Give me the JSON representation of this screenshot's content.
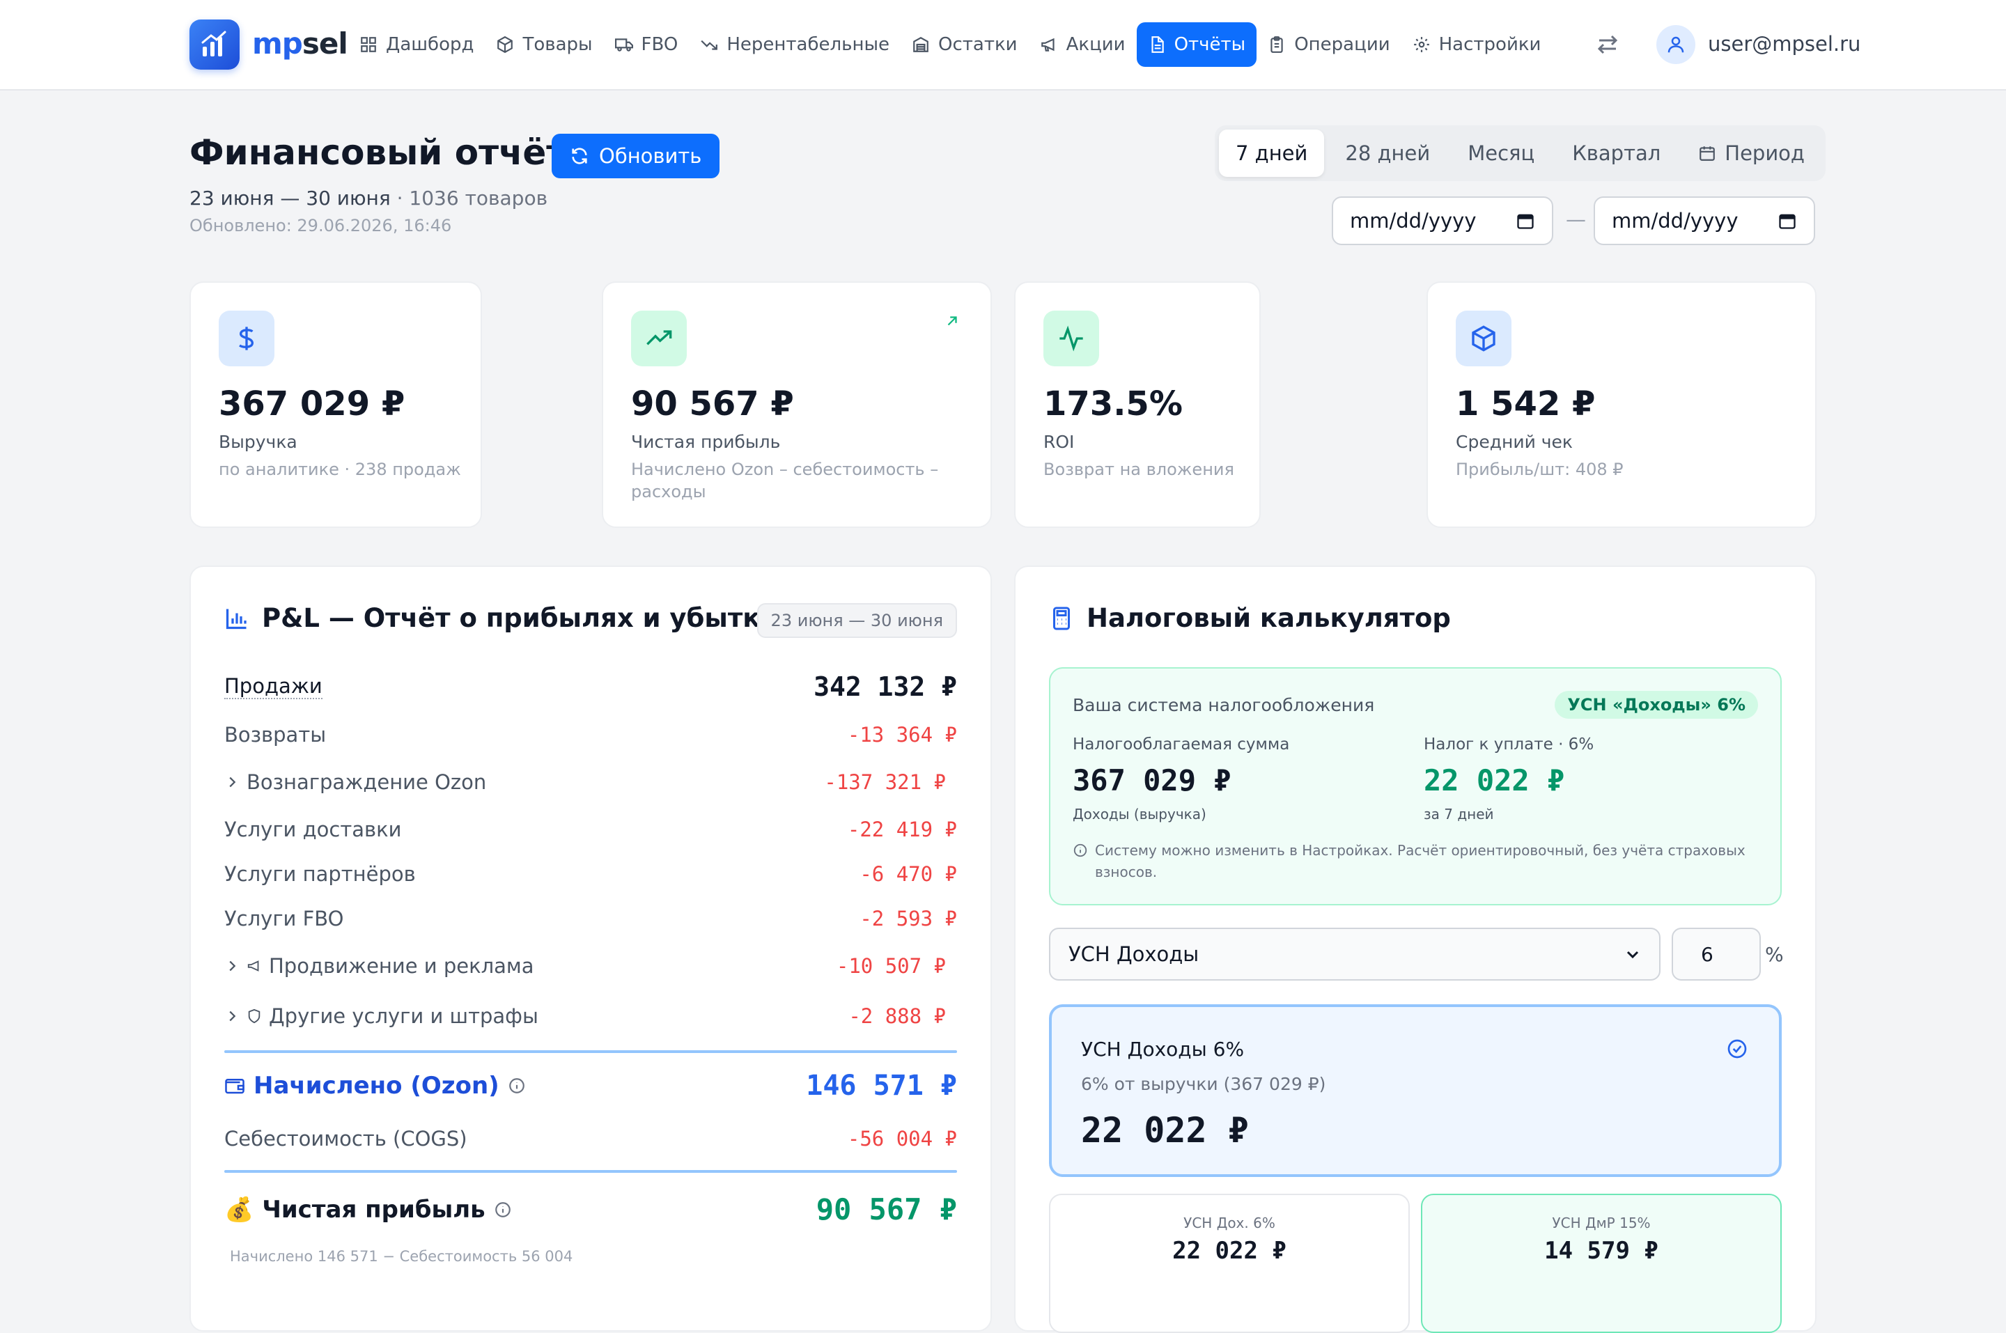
{
  "brand": {
    "part1": "mp",
    "part2": "sel"
  },
  "nav": [
    {
      "label": "Дашборд",
      "icon": "grid-icon",
      "active": false
    },
    {
      "label": "Товары",
      "icon": "box-icon",
      "active": false
    },
    {
      "label": "FBO",
      "icon": "truck-icon",
      "active": false
    },
    {
      "label": "Нерентабельные",
      "icon": "trending-down-icon",
      "active": false
    },
    {
      "label": "Остатки",
      "icon": "warehouse-icon",
      "active": false
    },
    {
      "label": "Акции",
      "icon": "megaphone-icon",
      "active": false
    },
    {
      "label": "Отчёты",
      "icon": "file-icon",
      "active": true
    },
    {
      "label": "Операции",
      "icon": "clipboard-icon",
      "active": false
    },
    {
      "label": "Настройки",
      "icon": "gear-icon",
      "active": false
    }
  ],
  "user": {
    "email": "user@mpsel.ru"
  },
  "page": {
    "title": "Финансовый отчёт",
    "refresh_label": "Обновить",
    "date_range": "23 июня — 30 июня",
    "products": "· 1036 товаров",
    "updated": "Обновлено: 29.06.2026, 16:46"
  },
  "periods": [
    "7 дней",
    "28 дней",
    "Месяц",
    "Квартал",
    "Период"
  ],
  "active_period": "7 дней",
  "date_inputs": {
    "from_placeholder": "mm/dd/yyyy",
    "to_placeholder": "mm/dd/yyyy",
    "separator": "—"
  },
  "kpis": [
    {
      "value": "367 029 ₽",
      "label": "Выручка",
      "sub": "по аналитике · 238 продаж",
      "icon": "dollar-icon",
      "bg": "#dbeafe",
      "fg": "#2563eb"
    },
    {
      "value": "90 567 ₽",
      "label": "Чистая прибыль",
      "sub": "Начислено Ozon – себестоимость – расходы",
      "icon": "trending-up-icon",
      "bg": "#d1fae5",
      "fg": "#059669"
    },
    {
      "value": "173.5%",
      "label": "ROI",
      "sub": "Возврат на вложения",
      "icon": "activity-icon",
      "bg": "#d1fae5",
      "fg": "#059669"
    },
    {
      "value": "1 542 ₽",
      "label": "Средний чек",
      "sub": "Прибыль/шт: 408 ₽",
      "icon": "cube-icon",
      "bg": "#dbeafe",
      "fg": "#2563eb"
    }
  ],
  "pl": {
    "title": "P&L — Отчёт о прибылях и убытках",
    "date_chip": "23 июня — 30 июня",
    "sales": {
      "label": "Продажи",
      "value": "342 132 ₽"
    },
    "rows": [
      {
        "label": "Возвраты",
        "value": "-13 364 ₽"
      },
      {
        "label": "Вознаграждение Ozon",
        "value": "-137 321 ₽"
      },
      {
        "label": "Услуги доставки",
        "value": "-22 419 ₽"
      },
      {
        "label": "Услуги партнёров",
        "value": "-6 470 ₽"
      },
      {
        "label": "Услуги FBO",
        "value": "-2 593 ₽"
      },
      {
        "label": "Продвижение и реклама",
        "value": "-10 507 ₽"
      },
      {
        "label": "Другие услуги и штрафы",
        "value": "-2 888 ₽"
      }
    ],
    "accrued": {
      "label": "Начислено (Ozon)",
      "value": "146 571 ₽"
    },
    "cogs": {
      "label": "Себестоимость (COGS)",
      "value": "-56 004 ₽"
    },
    "net": {
      "label": "Чистая прибыль",
      "value": "90 567 ₽",
      "emoji": "💰",
      "sub": "Начислено 146 571 − Себестоимость 56 004"
    }
  },
  "tax": {
    "title": "Налоговый калькулятор",
    "system_label": "Ваша система налогообложения",
    "badge": "УСН «Доходы» 6%",
    "taxable_label": "Налогооблагаемая сумма",
    "taxable_value": "367 029 ₽",
    "taxable_sub": "Доходы (выручка)",
    "due_label": "Налог к уплате · 6%",
    "due_value": "22 022 ₽",
    "due_sub": "за 7 дней",
    "note": "Систему можно изменить в Настройках. Расчёт ориентировочный, без учёта страховых взносов.",
    "select_value": "УСН Доходы",
    "rate_value": "6",
    "rate_unit": "%",
    "result_title": "УСН Доходы 6%",
    "result_desc": "6% от выручки (367 029 ₽)",
    "result_value": "22 022 ₽",
    "compare": [
      {
        "label": "УСН Дох. 6%",
        "value": "22 022 ₽"
      },
      {
        "label": "УСН ДмР 15%",
        "value": "14 579 ₽"
      }
    ]
  }
}
